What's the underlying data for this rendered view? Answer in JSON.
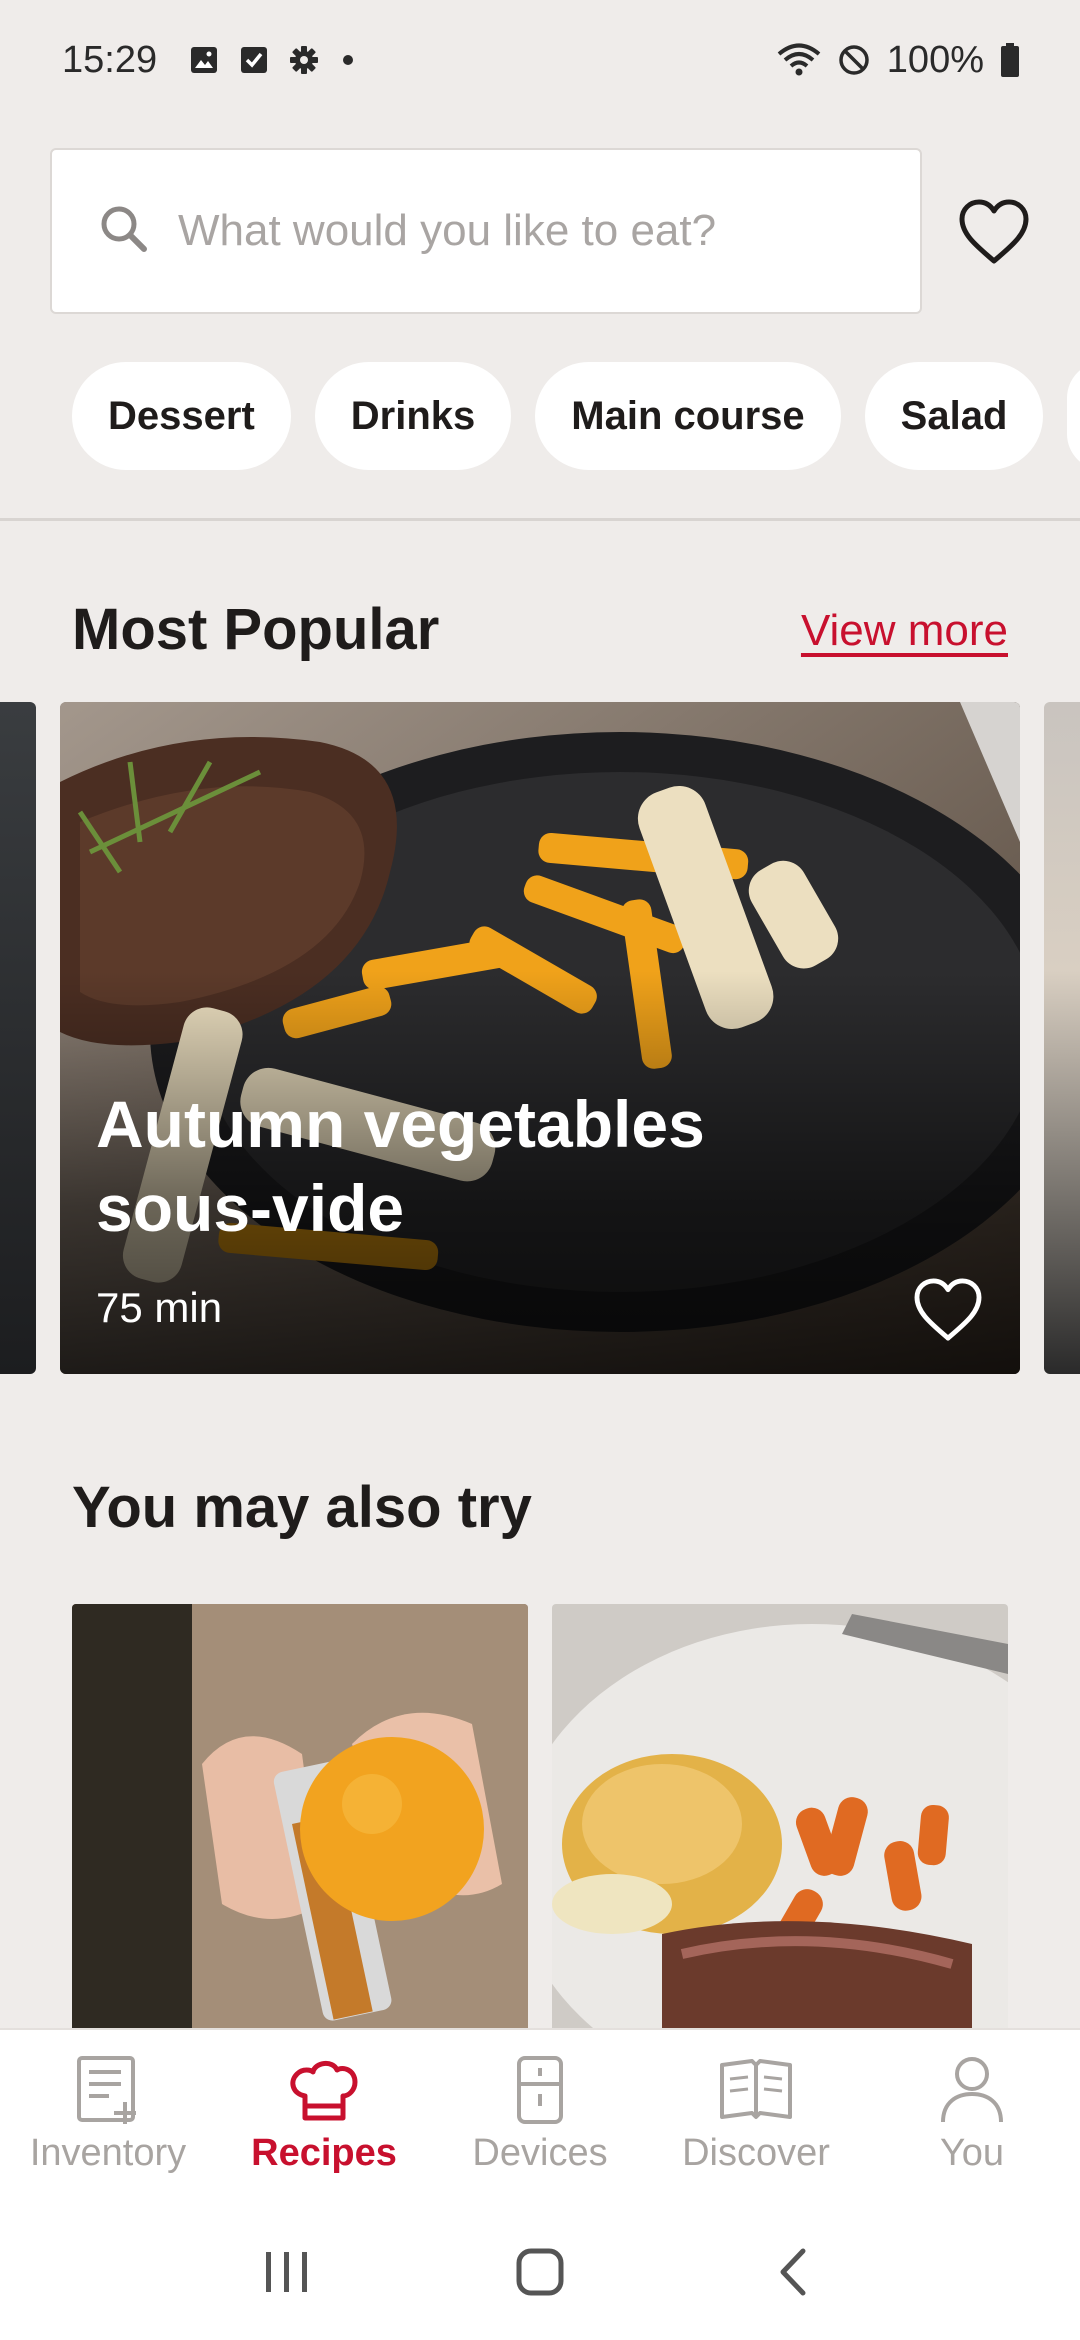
{
  "status_bar": {
    "time": "15:29",
    "battery": "100%",
    "left_icons": [
      "gallery-icon",
      "checkbox-icon",
      "gear-icon",
      "dot"
    ],
    "right_icons": [
      "wifi-icon",
      "no-disturb-icon",
      "battery-icon"
    ]
  },
  "search": {
    "placeholder": "What would you like to eat?"
  },
  "categories": [
    "Dessert",
    "Drinks",
    "Main course",
    "Salad"
  ],
  "most_popular": {
    "title": "Most Popular",
    "view_more": "View more",
    "featured": {
      "title": "Autumn vegetables sous-vide",
      "time": "75 min"
    }
  },
  "also_try": {
    "title": "You may also try"
  },
  "bottom_nav": {
    "items": [
      {
        "label": "Inventory",
        "icon": "inventory-icon",
        "active": false
      },
      {
        "label": "Recipes",
        "icon": "chef-hat-icon",
        "active": true
      },
      {
        "label": "Devices",
        "icon": "fridge-icon",
        "active": false
      },
      {
        "label": "Discover",
        "icon": "book-icon",
        "active": false
      },
      {
        "label": "You",
        "icon": "person-icon",
        "active": false
      }
    ]
  },
  "colors": {
    "accent": "#c8102e",
    "background": "#efecea",
    "nav_inactive": "#a8a4a1"
  }
}
